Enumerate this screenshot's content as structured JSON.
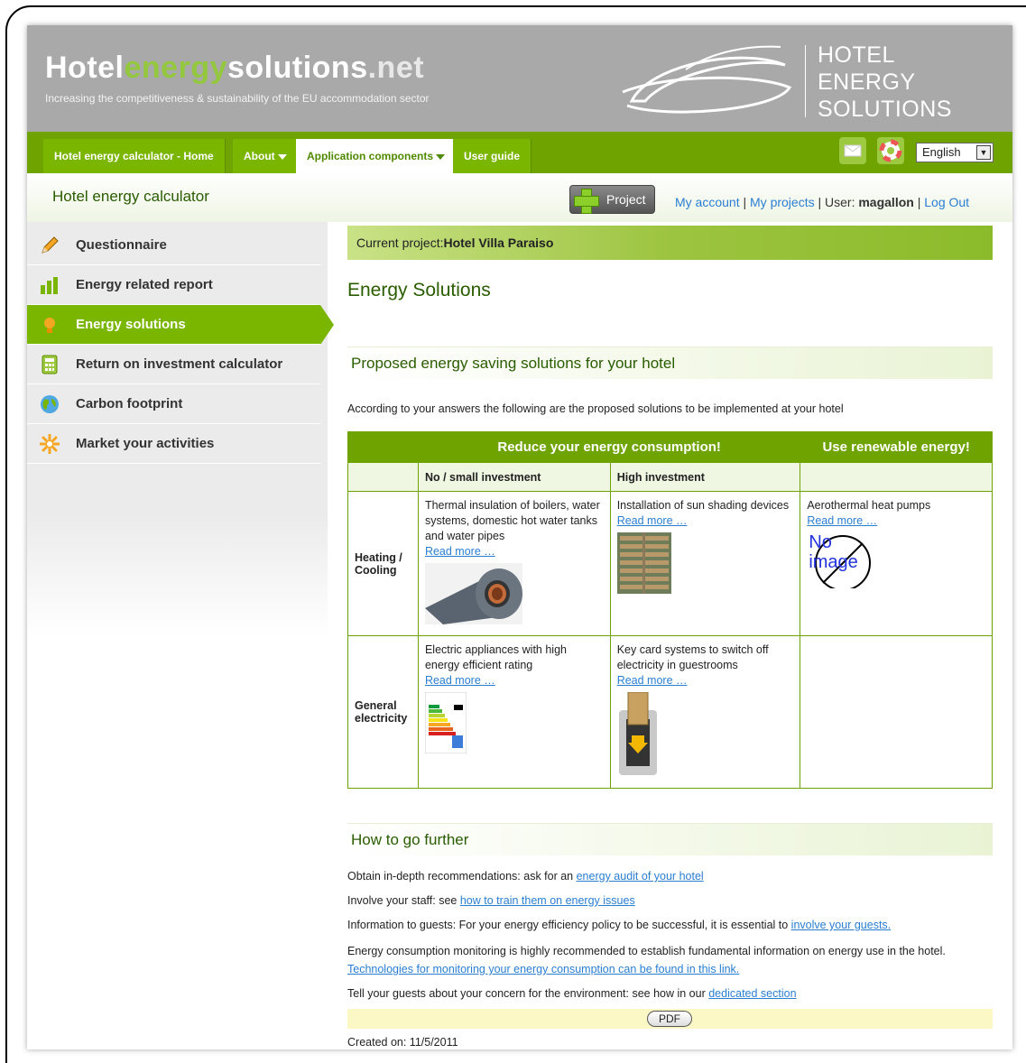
{
  "header": {
    "logo_part1": "Hotel",
    "logo_part2": "energy",
    "logo_part3": "solutions",
    "logo_part4": ".net",
    "tagline": "Increasing the competitiveness & sustainability of the EU accommodation sector",
    "brand_line1": "HOTEL",
    "brand_line2": "ENERGY",
    "brand_line3": "SOLUTIONS"
  },
  "nav": {
    "tabs": [
      {
        "label": "Hotel energy calculator - Home"
      },
      {
        "label": "About"
      },
      {
        "label": "Application components"
      },
      {
        "label": "User guide"
      }
    ],
    "language": "English"
  },
  "subheader": {
    "title": "Hotel energy calculator",
    "project_button": "Project",
    "my_account": "My account",
    "my_projects": "My projects",
    "user_label": "User:",
    "username": "magallon",
    "logout": "Log Out"
  },
  "sidebar": {
    "items": [
      {
        "label": "Questionnaire",
        "icon": "pencil-icon"
      },
      {
        "label": "Energy related report",
        "icon": "bar-chart-icon"
      },
      {
        "label": "Energy solutions",
        "icon": "lightbulb-icon"
      },
      {
        "label": "Return on investment calculator",
        "icon": "calculator-icon"
      },
      {
        "label": "Carbon footprint",
        "icon": "globe-icon"
      },
      {
        "label": "Market your activities",
        "icon": "sun-icon"
      }
    ]
  },
  "main": {
    "current_project_label": "Current project:",
    "current_project_name": "Hotel Villa Paraiso",
    "heading": "Energy Solutions",
    "proposed_heading": "Proposed energy saving solutions for your hotel",
    "intro": "According to your answers the following are the proposed solutions to be implemented at your hotel",
    "table": {
      "header_reduce": "Reduce your energy consumption!",
      "header_renew": "Use renewable energy!",
      "col_small": "No / small investment",
      "col_high": "High investment",
      "read_more": "Read more …",
      "rows": [
        {
          "label_line1": "Heating /",
          "label_line2": "Cooling",
          "small": "Thermal insulation of boilers, water systems, domestic hot water tanks and water pipes",
          "high": "Installation of sun shading devices",
          "renew": "Aerothermal heat pumps",
          "no_image_line1": "No",
          "no_image_line2": "image"
        },
        {
          "label_line1": "General",
          "label_line2": "electricity",
          "small": "Electric appliances with high energy efficient rating",
          "high": "Key card systems to switch off electricity in guestrooms"
        }
      ]
    },
    "further_heading": "How to go further",
    "further": [
      {
        "text": "Obtain in-depth recommendations: ask for an ",
        "link": "energy audit of your hotel"
      },
      {
        "text": "Involve your staff: see ",
        "link": "how to train them on energy issues"
      },
      {
        "text": "Information to guests: For your energy efficiency policy to be successful, it is essential to ",
        "link": "involve your guests."
      },
      {
        "text": "Energy consumption monitoring is highly recommended to establish fundamental information on energy use in the hotel.",
        "link": ""
      },
      {
        "text": "",
        "link": "Technologies for monitoring your energy consumption can be found in this link."
      },
      {
        "text": "Tell your guests about your concern for the environment: see how in our ",
        "link": "dedicated section"
      }
    ],
    "pdf_button": "PDF",
    "created_label": "Created on: 11/5/2011"
  },
  "colors": {
    "brand_green": "#6fa300",
    "light_green": "#93c83e",
    "header_gray": "#a9a9a9",
    "link_blue": "#2a7ed2"
  }
}
